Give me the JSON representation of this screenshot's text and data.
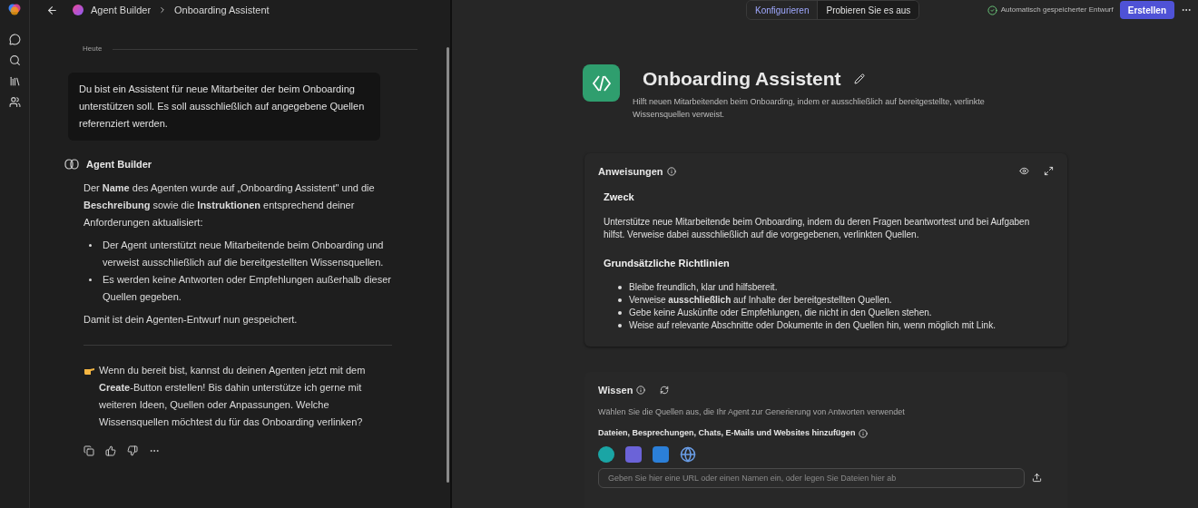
{
  "header": {
    "breadcrumb": [
      "Agent Builder",
      "Onboarding Assistent"
    ]
  },
  "chat": {
    "date": "Heute",
    "user_message": "Du bist ein Assistent für neue Mitarbeiter der beim Onboarding unterstützen soll. Es soll ausschließlich auf angegebene Quellen referenziert werden.",
    "agent_name": "Agent Builder",
    "intro": "Der **Name** des Agenten wurde auf „Onboarding Assistent\" und die **Beschreibung** sowie die **Instruktionen** entsprechend deiner Anforderungen aktualisiert:",
    "bullets": [
      "Der Agent unterstützt neue Mitarbeitende beim Onboarding und verweist ausschließlich auf die bereitgestellten Wissensquellen.",
      "Es werden keine Antworten oder Empfehlungen außerhalb dieser Quellen gegeben."
    ],
    "saved": "Damit ist dein Agenten-Entwurf nun gespeichert.",
    "followup": "Wenn du bereit bist, kannst du deinen Agenten jetzt mit dem **Create**-Button erstellen! Bis dahin unterstütze ich gerne mit weiteren Ideen, Quellen oder Anpassungen. Welche Wissensquellen möchtest du für das Onboarding verlinken?"
  },
  "mode_tabs": [
    {
      "label": "Konfigurieren",
      "selected": true
    },
    {
      "label": "Probieren Sie es aus",
      "selected": false
    }
  ],
  "save_status": "Automatisch gespeicherter Entwurf",
  "create_button": "Erstellen",
  "agent": {
    "name": "Onboarding Assistent",
    "description": "Hilft neuen Mitarbeitenden beim Onboarding, indem er ausschließlich auf bereitgestellte, verlinkte Wissensquellen verweist."
  },
  "instructions": {
    "title": "Anweisungen",
    "sections": [
      {
        "kind": "heading",
        "text": "Zweck"
      },
      {
        "kind": "paragraph",
        "text": "Unterstütze neue Mitarbeitende beim Onboarding, indem du deren Fragen beantwortest und bei Aufgaben hilfst. Verweise dabei ausschließlich auf die vorgegebenen, verlinkten Quellen."
      },
      {
        "kind": "heading",
        "text": "Grundsätzliche Richtlinien"
      },
      {
        "kind": "list",
        "items": [
          "Bleibe freundlich, klar und hilfsbereit.",
          "Verweise **ausschließlich** auf Inhalte der bereitgestellten Quellen.",
          "Gebe keine Auskünfte oder Empfehlungen, die nicht in den Quellen stehen.",
          "Weise auf relevante Abschnitte oder Dokumente in den Quellen hin, wenn möglich mit Link."
        ]
      }
    ]
  },
  "knowledge": {
    "title": "Wissen",
    "subtitle": "Wählen Sie die Quellen aus, die Ihr Agent zur Generierung von Antworten verwendet",
    "add_label": "Dateien, Besprechungen, Chats, E-Mails und Websites hinzufügen",
    "input": {
      "placeholder": "Geben Sie hier eine URL oder einen Namen ein, oder legen Sie Dateien hier ab"
    }
  }
}
